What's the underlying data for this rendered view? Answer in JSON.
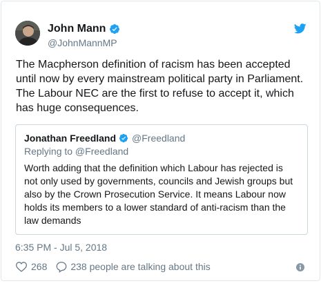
{
  "author": {
    "name": "John Mann",
    "handle": "@JohnMannMP",
    "verified": true
  },
  "tweet": {
    "text": "The Macpherson definition of racism has been accepted until now by every mainstream political party in Parliament. The Labour NEC are the first to refuse to accept it, which has huge consequences.",
    "timestamp": "6:35 PM - Jul 5, 2018"
  },
  "quoted": {
    "name": "Jonathan Freedland",
    "handle": "@Freedland",
    "verified": true,
    "replying_to": "Replying to @Freedland",
    "text": "Worth adding that the definition which Labour has rejected is not only used by governments, councils and Jewish groups but also by the Crown Prosecution Service. It means Labour now holds its members to a lower standard of anti-racism than the law demands"
  },
  "engagement": {
    "likes": "268",
    "talking": "238 people are talking about this"
  },
  "icons": {
    "brand": "twitter-bird-icon",
    "verified": "verified-badge-icon",
    "like": "heart-icon",
    "reply": "speech-bubble-icon",
    "info": "info-icon"
  },
  "colors": {
    "twitter_blue": "#1da1f2",
    "text": "#14171a",
    "secondary_text": "#657786",
    "border": "#e1e8ed"
  }
}
